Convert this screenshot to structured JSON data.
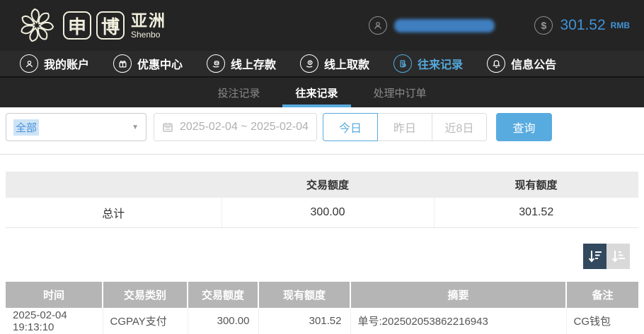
{
  "topbar": {
    "logo": {
      "char1": "申",
      "char2": "博",
      "region": "亚洲",
      "en": "Shenbo"
    },
    "balance": {
      "amount": "301.52",
      "currency": "RMB",
      "coin_symbol": "$"
    }
  },
  "navbar": {
    "items": [
      {
        "label": "我的账户",
        "icon": "user-icon",
        "active": false
      },
      {
        "label": "优惠中心",
        "icon": "gift-icon",
        "active": false
      },
      {
        "label": "线上存款",
        "icon": "deposit-icon",
        "active": false
      },
      {
        "label": "线上取款",
        "icon": "withdraw-icon",
        "active": false
      },
      {
        "label": "往来记录",
        "icon": "records-icon",
        "active": true
      },
      {
        "label": "信息公告",
        "icon": "bell-icon",
        "active": false
      }
    ]
  },
  "subtabs": {
    "items": [
      {
        "label": "投注记录",
        "active": false
      },
      {
        "label": "往来记录",
        "active": true
      },
      {
        "label": "处理中订单",
        "active": false
      }
    ]
  },
  "filters": {
    "type_select": {
      "value": "全部"
    },
    "date_range": {
      "value": "2025-02-04 ~ 2025-02-04"
    },
    "range_buttons": [
      {
        "label": "今日",
        "active": true
      },
      {
        "label": "昨日",
        "active": false
      },
      {
        "label": "近8日",
        "active": false
      }
    ],
    "query_label": "查询"
  },
  "summary_table": {
    "headers": {
      "col1": "",
      "col2": "交易额度",
      "col3": "现有额度"
    },
    "total_row": {
      "label": "总计",
      "amount": "300.00",
      "balance": "301.52"
    }
  },
  "records_table": {
    "headers": {
      "time": "时间",
      "type": "交易类别",
      "amount": "交易额度",
      "balance": "现有额度",
      "memo": "摘要",
      "note": "备注"
    },
    "rows": [
      {
        "time": "2025-02-04 19:13:10",
        "type": "CGPAY支付",
        "amount": "300.00",
        "balance": "301.52",
        "memo": "单号:202502053862216943",
        "note": "CG钱包"
      }
    ]
  },
  "colors": {
    "accent_blue": "#58abdf",
    "balance_blue": "#4193d6",
    "logo_cream": "#f0eedd",
    "topbar_bg": "#242424",
    "table_header_gray": "#b5b5b5",
    "sort_dark": "#32495e",
    "sort_light": "#d9d9d9"
  }
}
